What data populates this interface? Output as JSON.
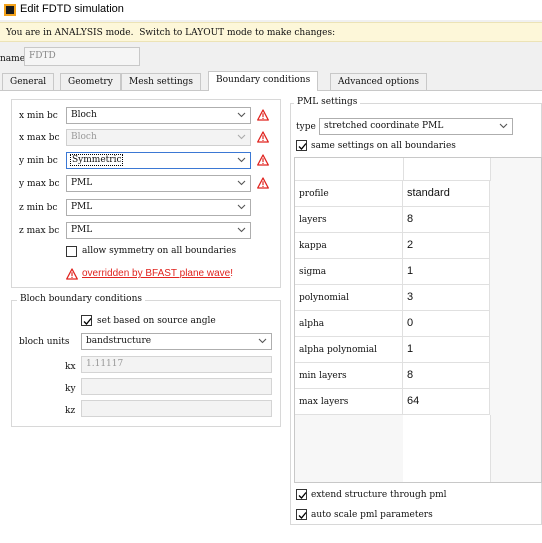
{
  "window": {
    "title": "Edit FDTD simulation"
  },
  "info": {
    "message": "You are in ANALYSIS mode.  Switch to LAYOUT mode to make changes:"
  },
  "name": {
    "label": "name",
    "value": "FDTD"
  },
  "tabs": [
    "General",
    "Geometry",
    "Mesh settings",
    "Boundary conditions",
    "Advanced options"
  ],
  "active_tab": "Boundary conditions",
  "bc": {
    "rows": [
      {
        "label": "x min bc",
        "value": "Bloch",
        "disabled": false,
        "warn": true
      },
      {
        "label": "x max bc",
        "value": "Bloch",
        "disabled": true,
        "warn": true
      },
      {
        "label": "y min bc",
        "value": "Symmetric",
        "disabled": false,
        "warn": true
      },
      {
        "label": "y max bc",
        "value": "PML",
        "disabled": false,
        "warn": true
      },
      {
        "label": "z min bc",
        "value": "PML",
        "disabled": false,
        "warn": false
      },
      {
        "label": "z max bc",
        "value": "PML",
        "disabled": false,
        "warn": false
      }
    ],
    "allow_symmetry_label": "allow symmetry on all boundaries",
    "allow_symmetry_checked": false,
    "warning_link": "overridden by BFAST plane wave",
    "warning_suffix": "!"
  },
  "bloch": {
    "title": "Bloch boundary conditions",
    "set_based_label": "set based on source angle",
    "set_based_checked": true,
    "units_label": "bloch units",
    "units_value": "bandstructure",
    "kx_label": "kx",
    "kx_value": "1.11117",
    "ky_label": "ky",
    "ky_value": "",
    "kz_label": "kz",
    "kz_value": ""
  },
  "pml": {
    "title": "PML settings",
    "type_label": "type",
    "type_value": "stretched coordinate PML",
    "same_settings_label": "same settings on all boundaries",
    "same_settings_checked": true,
    "table": [
      {
        "key": "profile",
        "value": "standard"
      },
      {
        "key": "layers",
        "value": "8"
      },
      {
        "key": "kappa",
        "value": "2"
      },
      {
        "key": "sigma",
        "value": "1"
      },
      {
        "key": "polynomial",
        "value": "3"
      },
      {
        "key": "alpha",
        "value": "0"
      },
      {
        "key": "alpha polynomial",
        "value": "1"
      },
      {
        "key": "min layers",
        "value": "8"
      },
      {
        "key": "max layers",
        "value": "64"
      }
    ],
    "extend_label": "extend structure through pml",
    "extend_checked": true,
    "autoscale_label": "auto scale pml parameters",
    "autoscale_checked": true
  },
  "colors": {
    "warning": "#e0231e",
    "info_bg": "#fdf7d9",
    "focus": "#3b78d4"
  },
  "icons": {
    "warning": "warning-icon",
    "dropdown": "chevron-down-icon",
    "check": "checkmark-icon"
  }
}
